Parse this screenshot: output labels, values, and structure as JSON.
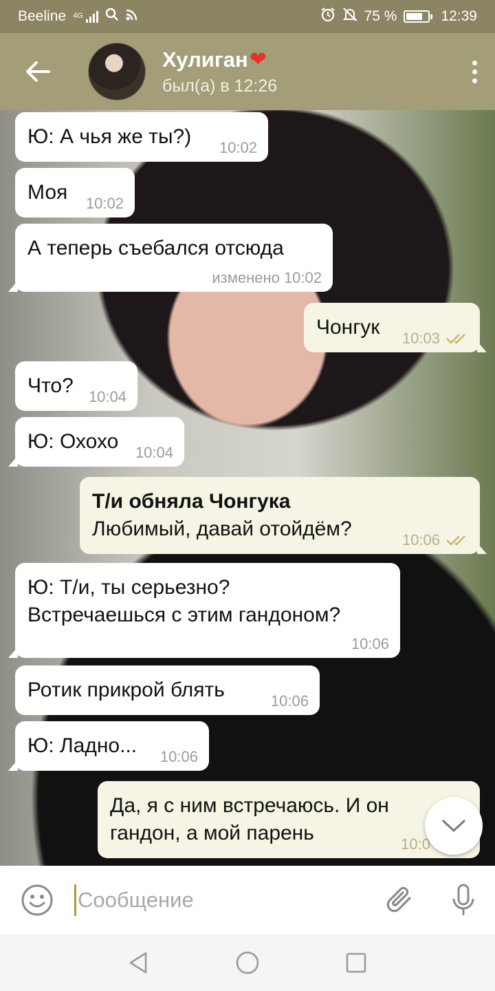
{
  "status_bar": {
    "carrier": "Beeline",
    "network": "4G",
    "battery_percent": "75 %",
    "battery_level": 0.75,
    "time": "12:39",
    "icons": [
      "signal-icon",
      "search-icon",
      "cast-icon",
      "alarm-icon",
      "mute-icon",
      "battery-icon"
    ]
  },
  "header": {
    "name": "Хулиган",
    "name_emoji": "❤",
    "status": "был(а) в 12:26",
    "icons": [
      "back-arrow-icon",
      "more-vertical-icon"
    ]
  },
  "messages": [
    {
      "dir": "in",
      "text": "Ю: А чья же ты?)",
      "time": "10:02"
    },
    {
      "dir": "in",
      "text": "Моя",
      "time": "10:02"
    },
    {
      "dir": "in",
      "text": "А теперь съебался отсюда",
      "time": "изменено 10:02"
    },
    {
      "dir": "out",
      "text": "Чонгук",
      "time": "10:03",
      "read": true
    },
    {
      "dir": "in",
      "text": "Что?",
      "time": "10:04"
    },
    {
      "dir": "in",
      "text": "Ю: Охохо",
      "time": "10:04"
    },
    {
      "dir": "out",
      "bold_line": "Т/и обняла Чонгука",
      "text": "Любимый, давай отойдём?",
      "time": "10:06",
      "read": true
    },
    {
      "dir": "in",
      "line1": "Ю: Т/и, ты серьезно?",
      "line2": "Встречаешься с этим гандоном?",
      "time": "10:06"
    },
    {
      "dir": "in",
      "text": "Ротик прикрой блять",
      "time": "10:06"
    },
    {
      "dir": "in",
      "text": "Ю: Ладно...",
      "time": "10:06"
    },
    {
      "dir": "out",
      "line1": "Да, я с ним встречаюсь. И он",
      "line2": "гандон, а мой парень",
      "time": "10:0"
    }
  ],
  "input": {
    "placeholder": "Сообщение",
    "icons": [
      "emoji-icon",
      "attach-icon",
      "microphone-icon"
    ]
  },
  "nav": {
    "icons": [
      "back-triangle-icon",
      "home-circle-icon",
      "recents-square-icon"
    ]
  },
  "colors": {
    "status_bar": "#8c8564",
    "header": "#a39d78",
    "incoming_bubble": "#ffffff",
    "outgoing_bubble": "#f6f4e4",
    "read_check": "#c7b66a",
    "cursor": "#b49a2b"
  }
}
